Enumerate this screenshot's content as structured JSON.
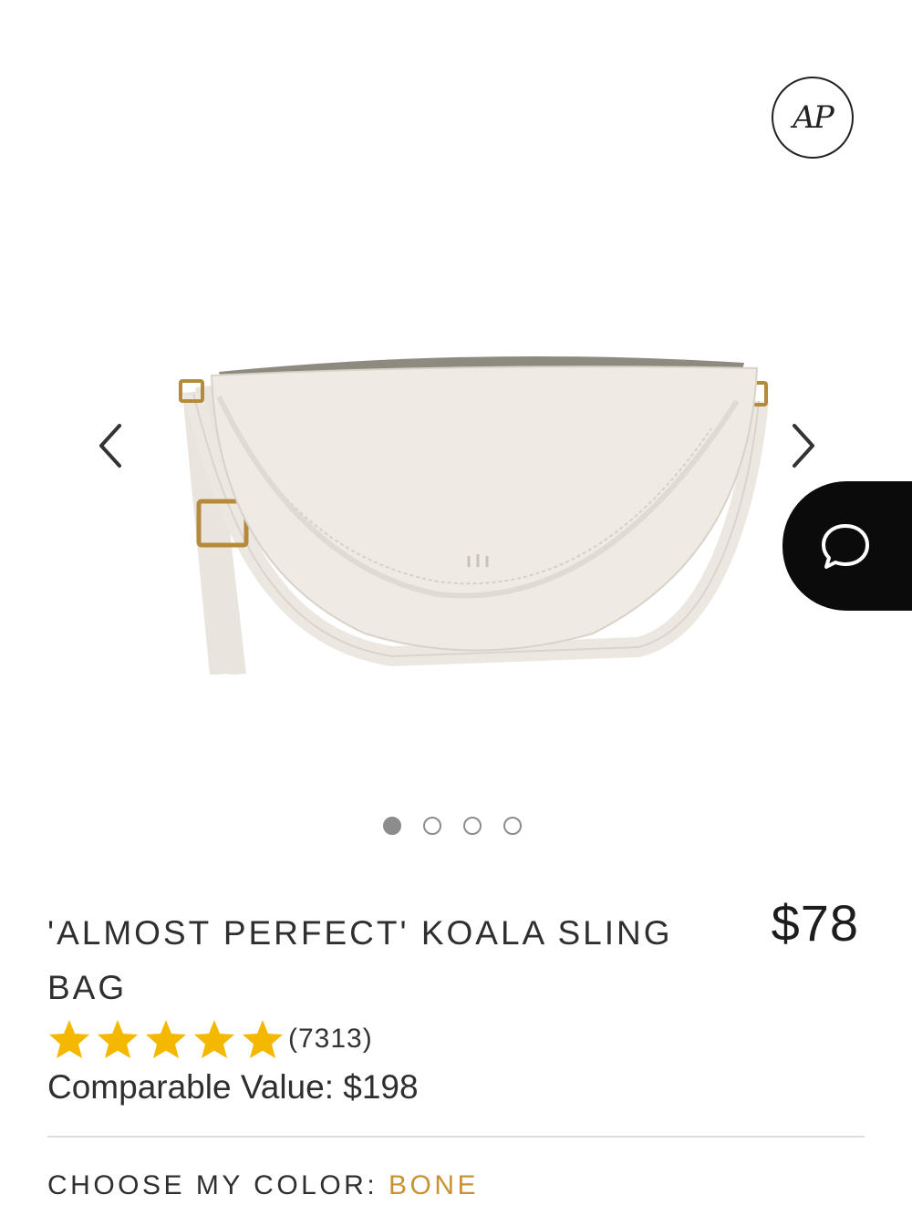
{
  "gallery": {
    "prev_label": "Previous image",
    "next_label": "Next image",
    "slide_count": 4,
    "active_slide": 1
  },
  "badge": {
    "text": "AP"
  },
  "product": {
    "title": "'ALMOST PERFECT' KOALA SLING BAG",
    "price": "$78",
    "rating": {
      "stars": 5,
      "count_text": "(7313)"
    },
    "comparable_value": "Comparable Value: $198"
  },
  "color_selector": {
    "label": "CHOOSE MY COLOR:",
    "value": "BONE",
    "value_color": "#c99233"
  },
  "colors": {
    "star": "#f5b800",
    "chat_bg": "#0b0b0b",
    "dot": "#8c8c8c"
  },
  "icons": [
    "ap-logo-icon",
    "chevron-left-icon",
    "chevron-right-icon",
    "chat-bubble-icon",
    "star-icon"
  ]
}
